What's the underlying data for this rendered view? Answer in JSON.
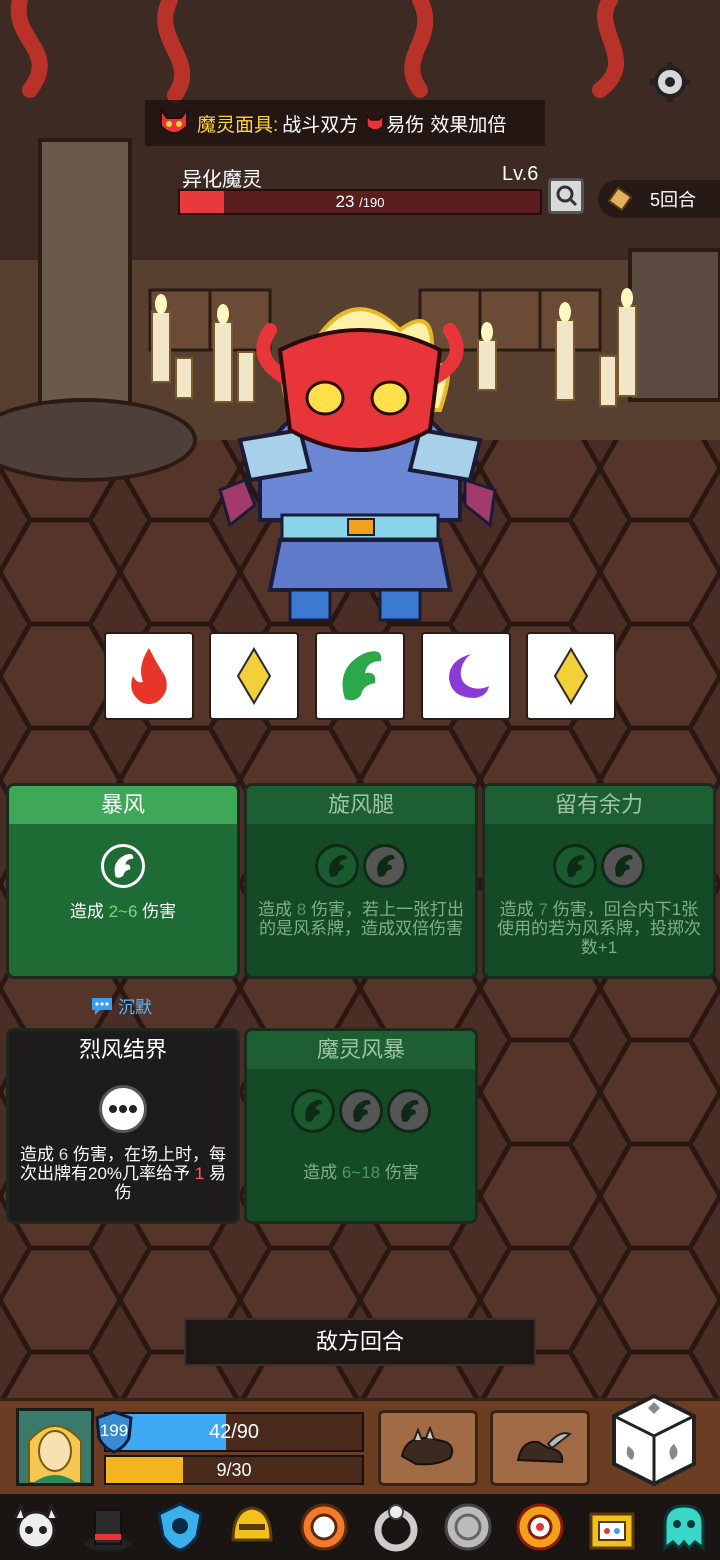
{
  "banner": {
    "prefix": "魔灵面具:",
    "target": "战斗双方",
    "effect": "易伤",
    "suffix": "效果加倍"
  },
  "enemy": {
    "name": "异化魔灵",
    "level": "Lv.6",
    "hp_current": "23",
    "hp_max": "/190",
    "hp_fraction": 0.121
  },
  "rounds": "5回合",
  "dice_tiles": [
    "fire-icon",
    "diamond-icon",
    "wind-icon",
    "moon-icon",
    "diamond-icon"
  ],
  "cards": [
    {
      "title": "暴风",
      "desc_pre": "造成 ",
      "desc_val": "2~6",
      "desc_post": " 伤害"
    },
    {
      "title": "旋风腿",
      "desc_pre": "造成 ",
      "desc_val": "8",
      "desc_post": " 伤害，若上一张打出的是风系牌，造成双倍伤害"
    },
    {
      "title": "留有余力",
      "desc_pre": "造成 ",
      "desc_val": "7",
      "desc_post": " 伤害，回合内下1张使用的若为",
      "desc_val2": "风系牌，投掷次数+1"
    },
    {
      "title": "烈风结界",
      "desc_pre": "造成 ",
      "desc_val": "6",
      "desc_post": " 伤害，在场上时，每次出牌有20%几率给予 ",
      "desc_val2": "1",
      "desc_post2": " 易伤"
    },
    {
      "title": "魔灵风暴",
      "desc_pre": "造成 ",
      "desc_val": "6~18",
      "desc_post": " 伤害"
    }
  ],
  "silence_label": "沉默",
  "end_turn": "敌方回合",
  "player": {
    "shield": "199",
    "life": "42/90",
    "life_fraction": 0.467,
    "energy": "9/30",
    "energy_fraction": 0.3
  },
  "relics": [
    "skull-viking-icon",
    "top-hat-icon",
    "blue-shield-icon",
    "gold-helmet-icon",
    "orange-ring-icon",
    "silver-ring-icon",
    "silver-coin-icon",
    "sun-flower-icon",
    "treasure-box-icon",
    "ghost-icon"
  ],
  "colors": {
    "wind": "#2aa84a",
    "fire": "#e8352a",
    "gold": "#f2d03a",
    "moon": "#8a3ad6",
    "hp": "#e83a3a",
    "life": "#3ea9f2",
    "energy": "#f2b521"
  }
}
